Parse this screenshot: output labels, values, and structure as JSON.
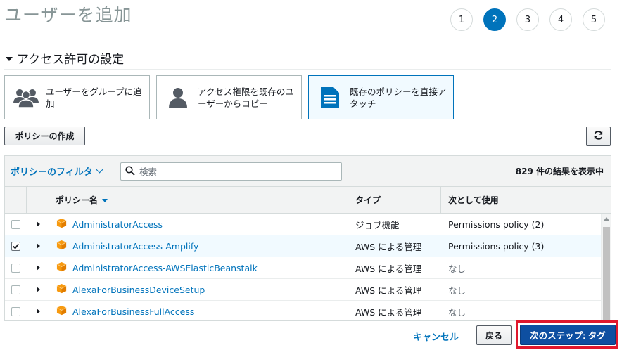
{
  "page": {
    "title": "ユーザーを追加"
  },
  "steps": [
    "1",
    "2",
    "3",
    "4",
    "5"
  ],
  "active_step": "2",
  "section": {
    "title": "アクセス許可の設定"
  },
  "options": [
    {
      "label": "ユーザーをグループに追加",
      "icon": "users-group-icon"
    },
    {
      "label": "アクセス権限を既存のユーザーからコピー",
      "icon": "user-icon"
    },
    {
      "label": "既存のポリシーを直接アタッチ",
      "icon": "document-icon",
      "selected": true
    }
  ],
  "toolbar": {
    "create_policy": "ポリシーの作成",
    "refresh_icon": "refresh-icon"
  },
  "filter": {
    "label": "ポリシーのフィルタ",
    "search_placeholder": "検索",
    "result_count": "829 件の結果を表示中"
  },
  "columns": {
    "name": "ポリシー名",
    "type": "タイプ",
    "used_as": "次として使用"
  },
  "rows": [
    {
      "name": "AdministratorAccess",
      "type": "ジョブ機能",
      "used_as": "Permissions policy (2)",
      "checked": false
    },
    {
      "name": "AdministratorAccess-Amplify",
      "type": "AWS による管理",
      "used_as": "Permissions policy (3)",
      "checked": true
    },
    {
      "name": "AdministratorAccess-AWSElasticBeanstalk",
      "type": "AWS による管理",
      "used_as": "なし",
      "checked": false
    },
    {
      "name": "AlexaForBusinessDeviceSetup",
      "type": "AWS による管理",
      "used_as": "なし",
      "checked": false
    },
    {
      "name": "AlexaForBusinessFullAccess",
      "type": "AWS による管理",
      "used_as": "なし",
      "checked": false
    }
  ],
  "footer": {
    "cancel": "キャンセル",
    "back": "戻る",
    "next": "次のステップ: タグ"
  },
  "colors": {
    "accent": "#0073bb",
    "next_button": "#0e4fa1",
    "highlight": "#e0182d"
  }
}
